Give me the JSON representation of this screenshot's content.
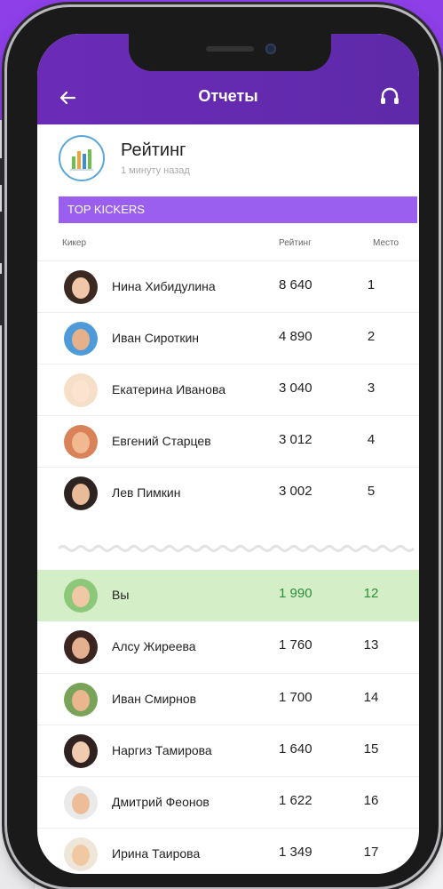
{
  "header": {
    "title": "Отчеты"
  },
  "report": {
    "title": "Рейтинг",
    "subtitle": "1 минуту назад"
  },
  "section": {
    "title": "TOP KICKERS"
  },
  "columns": {
    "kicker": "Кикер",
    "rating": "Рейтинг",
    "place": "Место"
  },
  "top_rows": [
    {
      "name": "Нина Хибидулина",
      "rating": "8 640",
      "place": "1"
    },
    {
      "name": "Иван Сироткин",
      "rating": "4 890",
      "place": "2"
    },
    {
      "name": "Екатерина Иванова",
      "rating": "3 040",
      "place": "3"
    },
    {
      "name": "Евгений Старцев",
      "rating": "3 012",
      "place": "4"
    },
    {
      "name": "Лев Пимкин",
      "rating": "3 002",
      "place": "5"
    }
  ],
  "you_row": {
    "name": "Вы",
    "rating": "1 990",
    "place": "12"
  },
  "bottom_rows": [
    {
      "name": "Алсу Жиреева",
      "rating": "1 760",
      "place": "13"
    },
    {
      "name": "Иван Смирнов",
      "rating": "1 700",
      "place": "14"
    },
    {
      "name": "Наргиз Тамирова",
      "rating": "1 640",
      "place": "15"
    },
    {
      "name": "Дмитрий Феонов",
      "rating": "1 622",
      "place": "16"
    },
    {
      "name": "Ирина Таирова",
      "rating": "1 349",
      "place": "17"
    }
  ],
  "icons": {
    "back": "arrow-left-icon",
    "support": "headset-icon",
    "report": "bar-chart-icon"
  },
  "colors": {
    "background_accent": "#8e3fe8",
    "header": "#6b2bb7",
    "section_bar": "#9b5ff0",
    "you_row": "#d4efc8",
    "you_text": "#2e8b3a"
  }
}
